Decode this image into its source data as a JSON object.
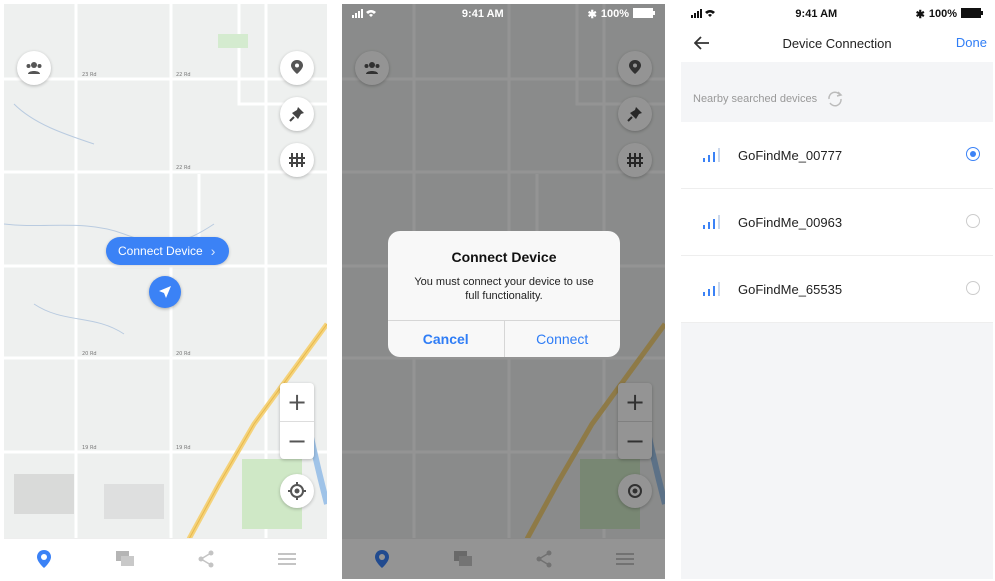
{
  "screen1": {
    "connect_pill_label": "Connect Device",
    "connect_pill_chevron": "›",
    "zoom_in": "+",
    "zoom_out": "−",
    "map_labels": [
      "23 Rd",
      "22 Rd",
      "22 Rd",
      "20 Rd",
      "20 Rd",
      "19 Rd",
      "19 Rd"
    ]
  },
  "screen2": {
    "status": {
      "time": "9:41 AM",
      "battery": "100%"
    },
    "zoom_in": "+",
    "zoom_out": "−",
    "dialog": {
      "title": "Connect Device",
      "message": "You must connect your device to use full functionality.",
      "cancel_label": "Cancel",
      "connect_label": "Connect"
    }
  },
  "screen3": {
    "status": {
      "time": "9:41 AM",
      "battery": "100%"
    },
    "nav": {
      "title": "Device Connection",
      "done_label": "Done"
    },
    "section_header": "Nearby searched devices",
    "devices": [
      {
        "name": "GoFindMe_00777",
        "selected": true
      },
      {
        "name": "GoFindMe_00963",
        "selected": false
      },
      {
        "name": "GoFindMe_65535",
        "selected": false
      }
    ]
  },
  "colors": {
    "accent": "#3b82f6",
    "link": "#2f7df6",
    "map_bg": "#eef0ef"
  },
  "icons": {
    "top_left": "group-icon",
    "right_stack": [
      "location-person-icon",
      "pin-icon",
      "fence-icon"
    ],
    "locate": "locate-icon",
    "tabs": [
      "map-pin-tab-icon",
      "messages-tab-icon",
      "share-tab-icon",
      "menu-tab-icon"
    ]
  }
}
